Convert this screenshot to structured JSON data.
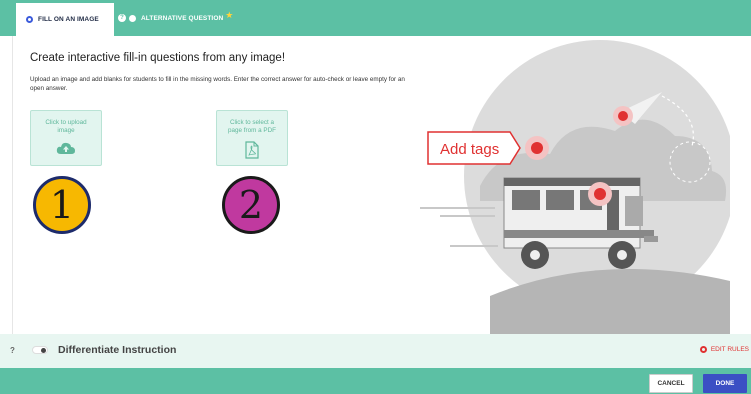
{
  "tabs": [
    {
      "label": "FILL ON AN IMAGE",
      "active": true
    },
    {
      "label": "ALTERNATIVE QUESTION",
      "active": false
    }
  ],
  "main": {
    "title": "Create interactive fill-in questions from any image!",
    "description": "Upload an image and add blanks for students to fill in the missing words. Enter the correct answer for auto-check or leave empty for an open answer.",
    "upload_image_label": "Click to upload image",
    "upload_pdf_label": "Click to select a page from a PDF",
    "badge_one": "1",
    "badge_two": "2",
    "illustration_label": "Add tags"
  },
  "differentiate": {
    "help": "?",
    "label": "Differentiate Instruction",
    "edit_rules": "EDIT RULES"
  },
  "footer": {
    "cancel": "CANCEL",
    "done": "DONE"
  },
  "colors": {
    "accent": "#5cc0a4",
    "primary_button": "#3b4fc4",
    "badge_one": "#f7b801",
    "badge_two": "#c0399f",
    "tag_red": "#e03131"
  }
}
